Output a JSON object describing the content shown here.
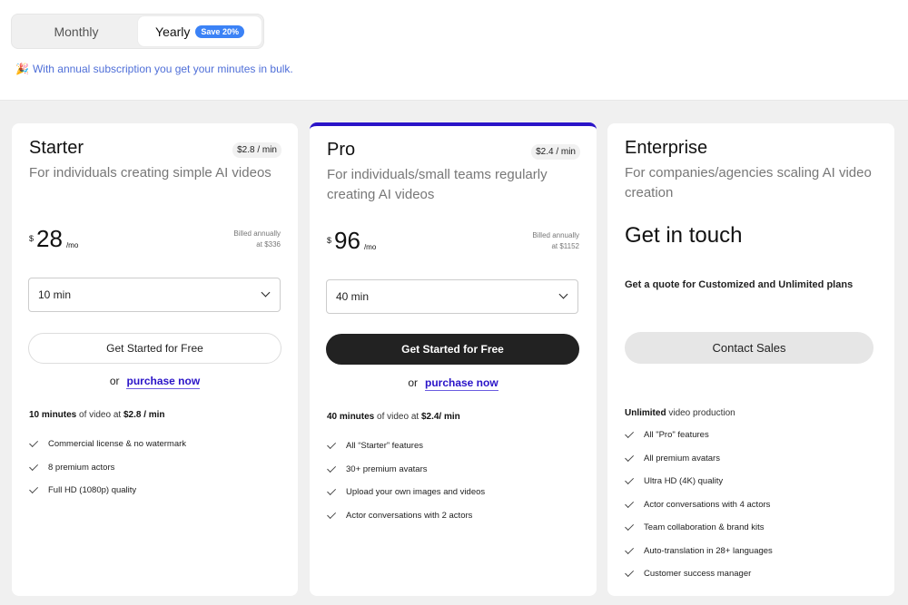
{
  "billing_toggle": {
    "options": [
      {
        "label": "Monthly",
        "selected": false
      },
      {
        "label": "Yearly",
        "selected": true,
        "badge": "Save 20%"
      }
    ]
  },
  "bulk_note": {
    "icon": "party-popper-icon",
    "icon_glyph": "🎉",
    "text": "With annual subscription you get your minutes in bulk."
  },
  "colors": {
    "accent": "#2a14c8",
    "badge": "#3b82f6",
    "link": "#4f6fd8",
    "page_bg": "#f0f0f0"
  },
  "plans": {
    "starter": {
      "name": "Starter",
      "rate": "$2.8 / min",
      "description": "For individuals creating simple AI videos",
      "currency": "$",
      "price": "28",
      "period": "/mo",
      "billed_line1": "Billed annually",
      "billed_line2": "at $336",
      "minutes_select": "10 min",
      "cta": "Get Started for Free",
      "or_text": "or",
      "purchase_link": "purchase now",
      "headline_bold": "10 minutes",
      "headline_mid": " of video at ",
      "headline_rate": "$2.8 / min",
      "features": [
        "Commercial license & no watermark",
        "8 premium actors",
        "Full HD (1080p) quality"
      ]
    },
    "pro": {
      "name": "Pro",
      "rate": "$2.4 / min",
      "description": "For individuals/small teams regularly creating AI videos",
      "currency": "$",
      "price": "96",
      "period": "/mo",
      "billed_line1": "Billed annually",
      "billed_line2": "at $1152",
      "minutes_select": "40 min",
      "cta": "Get Started for Free",
      "or_text": "or",
      "purchase_link": "purchase now",
      "headline_bold": "40 minutes",
      "headline_mid": " of video at ",
      "headline_rate": "$2.4/ min",
      "features": [
        "All  “Starter” features",
        "30+ premium avatars",
        "Upload your own images and videos",
        "Actor conversations with 2 actors"
      ]
    },
    "enterprise": {
      "name": "Enterprise",
      "description": "For companies/agencies scaling AI video creation",
      "cta_heading": "Get in touch",
      "quote_text": "Get a quote for Customized and Unlimited plans",
      "contact_button": "Contact Sales",
      "headline_bold": "Unlimited",
      "headline_mid": " video production",
      "features": [
        "All \"Pro\" features",
        "All premium avatars",
        "Ultra HD (4K) quality",
        "Actor conversations with 4 actors",
        "Team collaboration & brand kits",
        "Auto-translation in 28+ languages",
        "Customer success manager"
      ]
    }
  }
}
